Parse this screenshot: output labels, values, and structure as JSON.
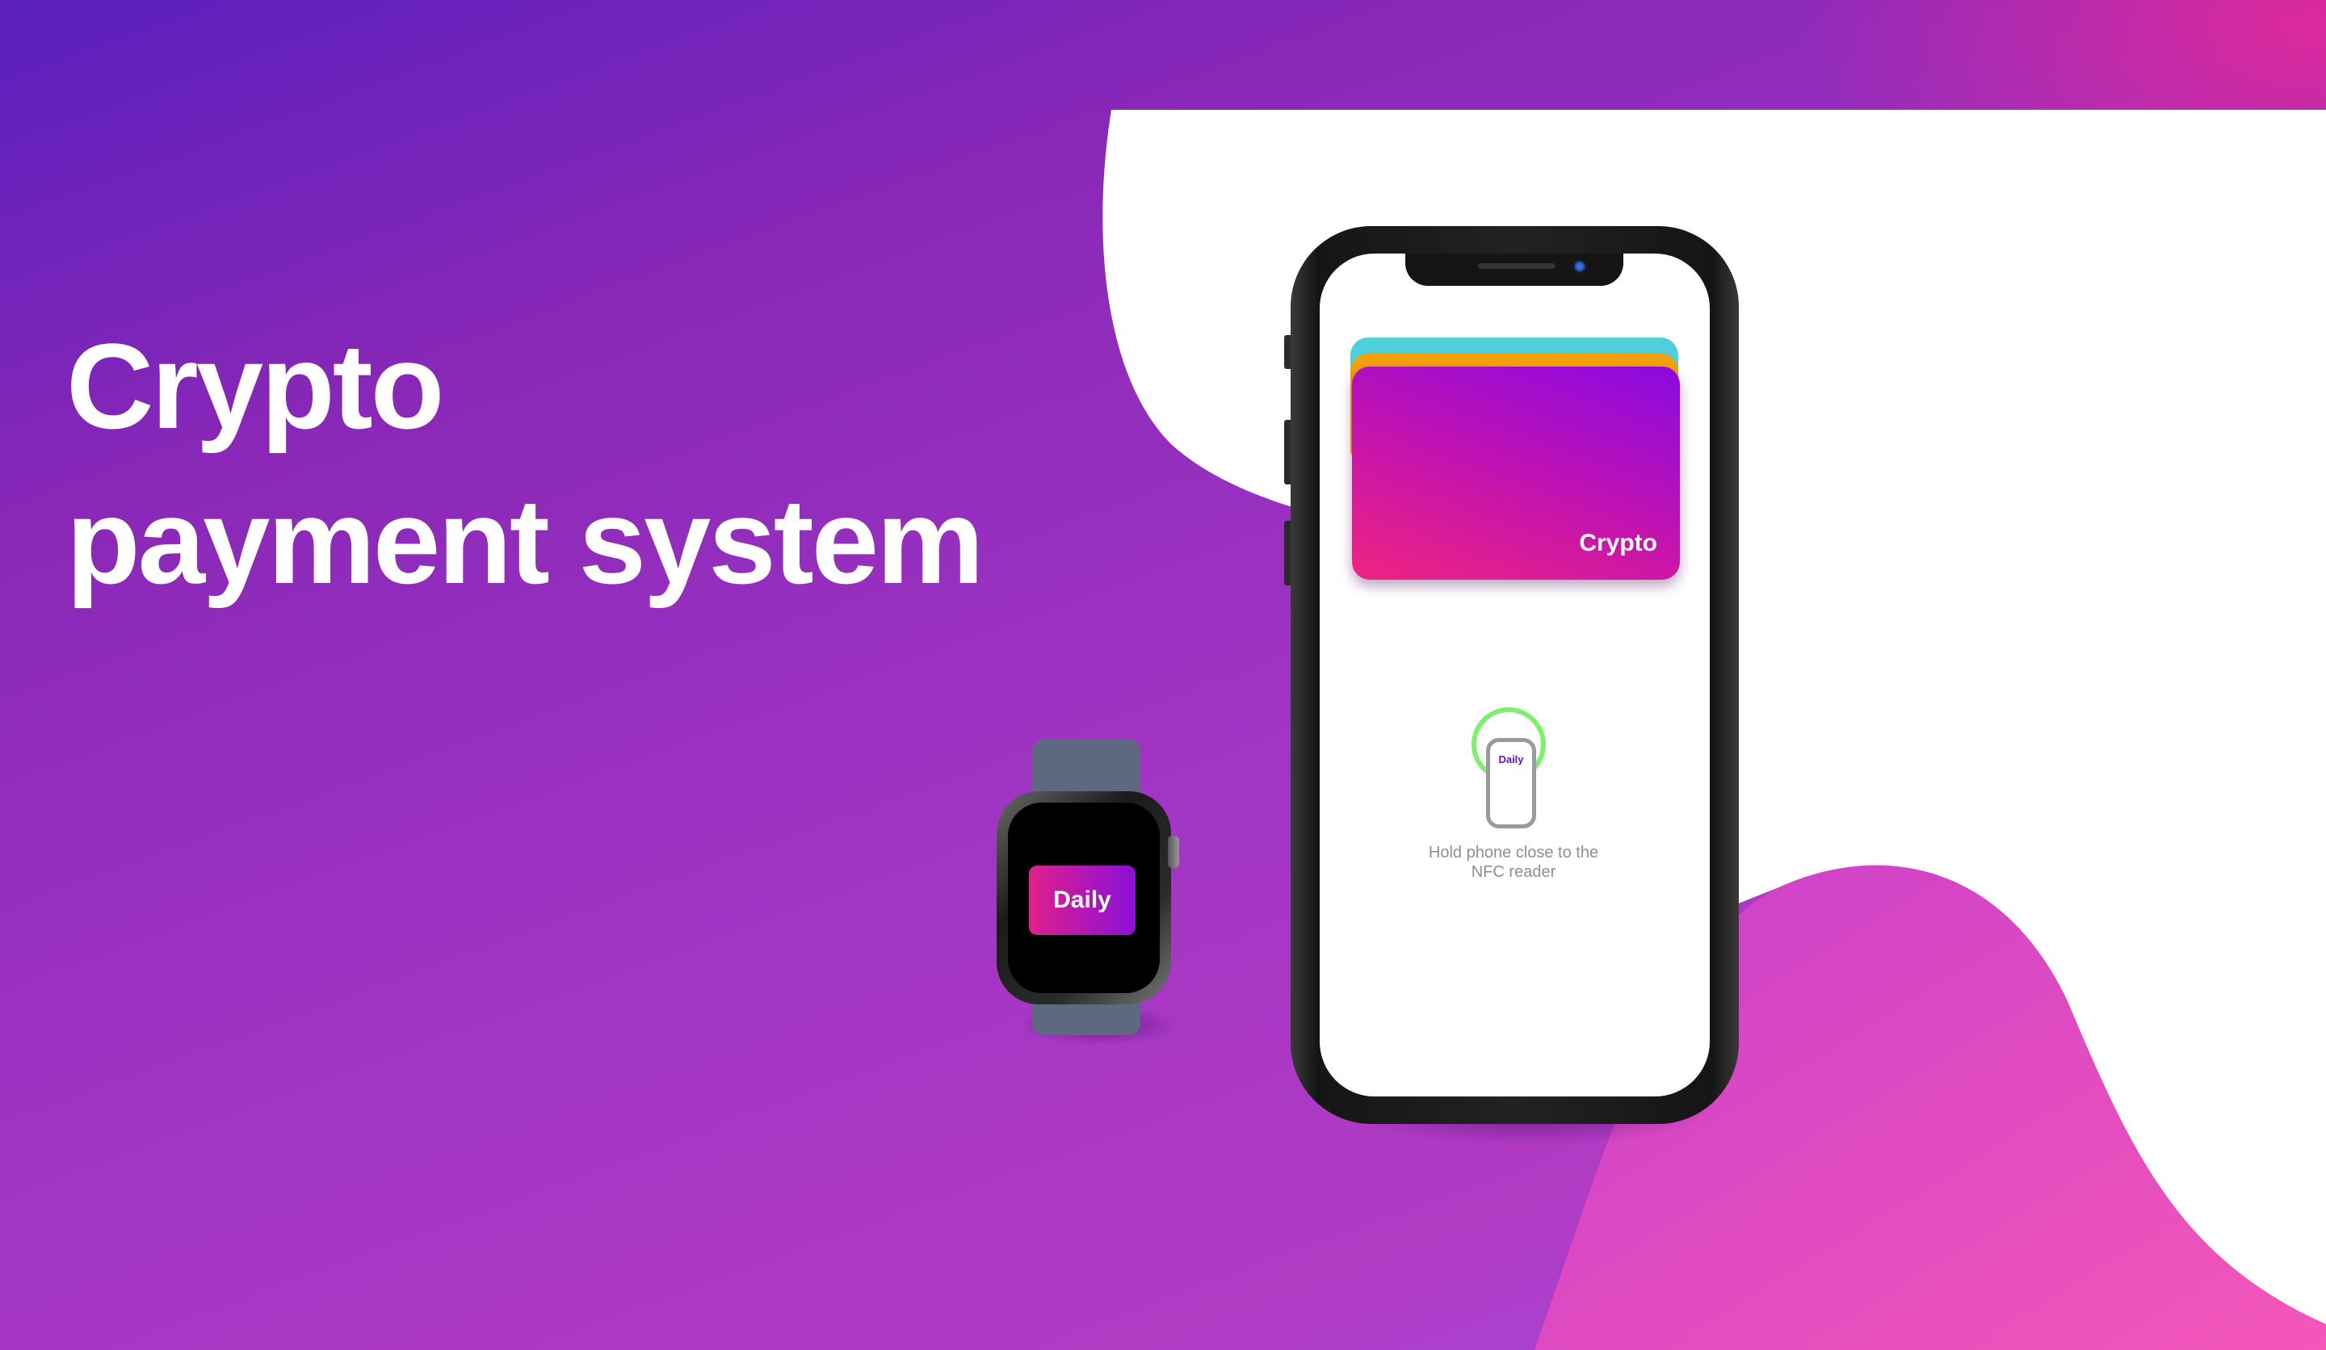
{
  "headline": {
    "line1": "Crypto",
    "line2": "payment system"
  },
  "watch": {
    "card_label": "Daily"
  },
  "phone": {
    "card_label": "Crypto",
    "nfc": {
      "mini_card_label": "Daily",
      "instruction": "Hold phone close to the NFC reader"
    }
  },
  "colors": {
    "background_start": "#5a1fbd",
    "background_end": "#e8288c",
    "card_gradient_start": "#8a0ae0",
    "card_gradient_end": "#ee2480",
    "card_teal": "#4ecfd9",
    "card_orange": "#f3a10c",
    "nfc_ring": "#7df06e"
  }
}
